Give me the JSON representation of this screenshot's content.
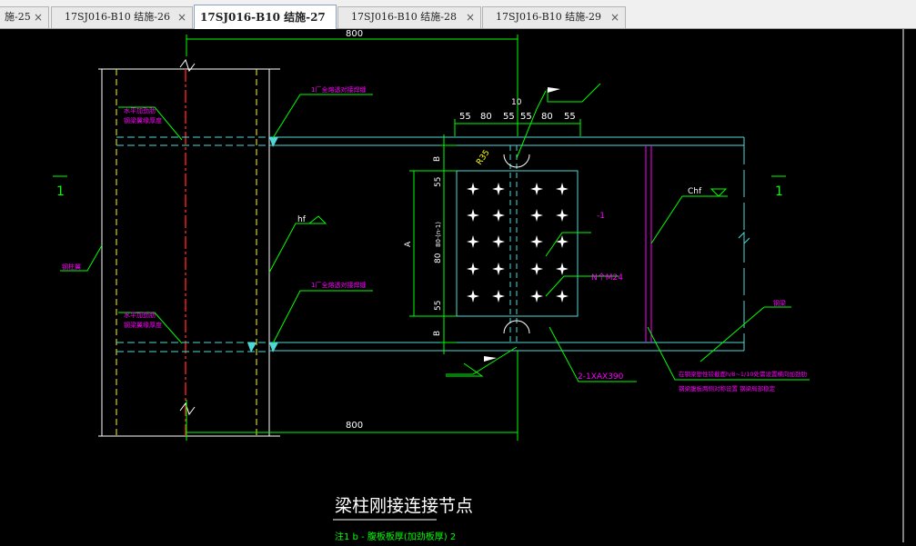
{
  "tabs": [
    {
      "label": "施-25",
      "close": "×",
      "active": false
    },
    {
      "label": "17SJ016-B10 结施-26",
      "close": "×",
      "active": false
    },
    {
      "label": "17SJ016-B10 结施-27",
      "close": "×",
      "active": true
    },
    {
      "label": "17SJ016-B10 结施-28",
      "close": "×",
      "active": false
    },
    {
      "label": "17SJ016-B10 结施-29",
      "close": "×",
      "active": false
    }
  ],
  "drawing": {
    "dim_top": "800",
    "dim_bottom": "800",
    "dim_10": "10",
    "bolt_spacing": [
      "55",
      "80",
      "55",
      "55",
      "80",
      "55"
    ],
    "left_dims": [
      "B",
      "55",
      "A",
      "80",
      "55",
      "B"
    ],
    "left_dim_small": "80·(n-1)",
    "section_left": "1",
    "section_right": "1",
    "label_r35": "R35",
    "label_weld_top": "1厂全熔透对接焊缝",
    "label_weld_bottom": "1厂全熔透对接焊缝",
    "label_stiff_top": [
      "水平加劲肋",
      "钢梁翼缘厚度"
    ],
    "label_stiff_bottom": [
      "水平加劲肋",
      "钢梁翼缘厚度"
    ],
    "label_col": "钢柱翼",
    "label_hf": "hf",
    "label_ch": "Chf",
    "label_minus1": "-1",
    "label_bolts": "N个M24",
    "label_plate": "2-1XAX390",
    "label_beam": "钢梁",
    "note_line1": "在钢梁塑性铰截面h/8~1/10处需设置横向加劲肋",
    "note_line2": "钢梁腹板两侧对称设置 钢梁局部稳定",
    "title": "梁柱刚接连接节点",
    "footnote": "注1 b - 腹板板厚(加劲板厚) 2"
  },
  "colors": {
    "background": "#000000",
    "green": "#00ff00",
    "cyan": "#4fd8d8",
    "magenta": "#ff00ff",
    "red": "#ff2020",
    "yellow": "#ffff00",
    "white": "#ffffff"
  }
}
